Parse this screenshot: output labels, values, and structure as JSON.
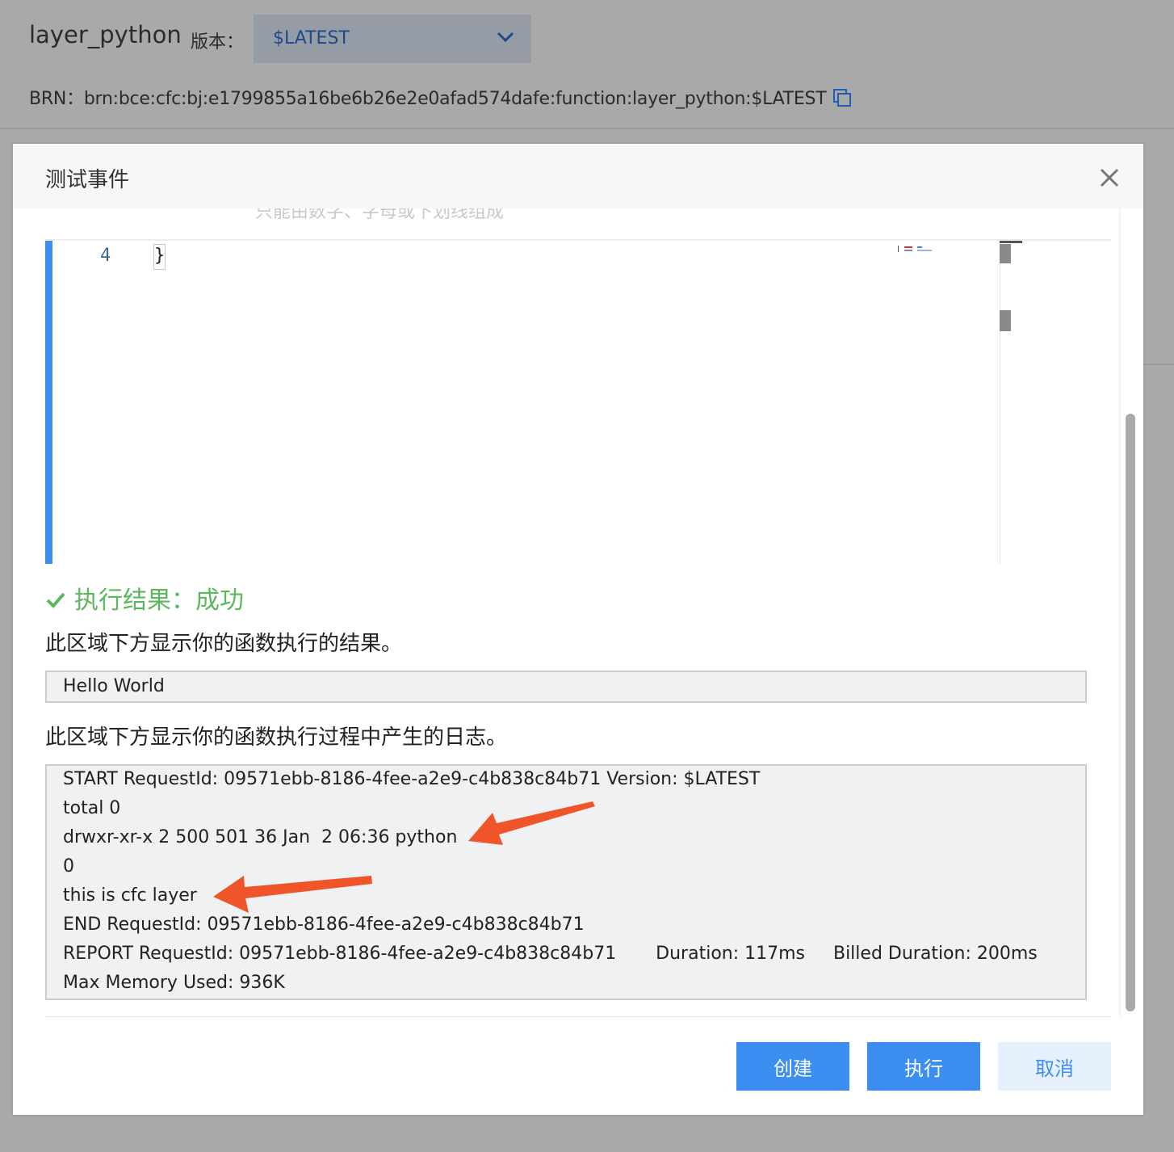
{
  "page": {
    "function_name": "layer_python",
    "version_label": "版本：",
    "version_selected": "$LATEST",
    "brn_label": "BRN：",
    "brn_value": "brn:bce:cfc:bj:e1799855a16be6b26e2e0afad574dafe:function:layer_python:$LATEST"
  },
  "modal": {
    "title": "测试事件",
    "cut_hint": "只能由数字、字母或下划线组成",
    "editor": {
      "line_number": "4",
      "line_text": "}"
    },
    "result_status": "执行结果：成功",
    "result_desc": "此区域下方显示你的函数执行的结果。",
    "result_output": "Hello World",
    "log_desc": "此区域下方显示你的函数执行过程中产生的日志。",
    "log_lines": [
      "START RequestId: 09571ebb-8186-4fee-a2e9-c4b838c84b71 Version: $LATEST",
      "total 0",
      "drwxr-xr-x 2 500 501 36 Jan  2 06:36 python",
      "0",
      "this is cfc layer",
      "END RequestId: 09571ebb-8186-4fee-a2e9-c4b838c84b71",
      "REPORT RequestId: 09571ebb-8186-4fee-a2e9-c4b838c84b71       Duration: 117ms     Billed Duration: 200ms",
      "Max Memory Used: 936K"
    ],
    "buttons": {
      "create": "创建",
      "run": "执行",
      "cancel": "取消"
    }
  },
  "colors": {
    "accent": "#3c8ff1",
    "success": "#5cb85c",
    "annotation_arrow": "#f0552a",
    "overlay": "#a9a9a9"
  },
  "icons": [
    "chevron-down-icon",
    "copy-icon",
    "close-icon",
    "check-icon",
    "arrow-annotation"
  ]
}
